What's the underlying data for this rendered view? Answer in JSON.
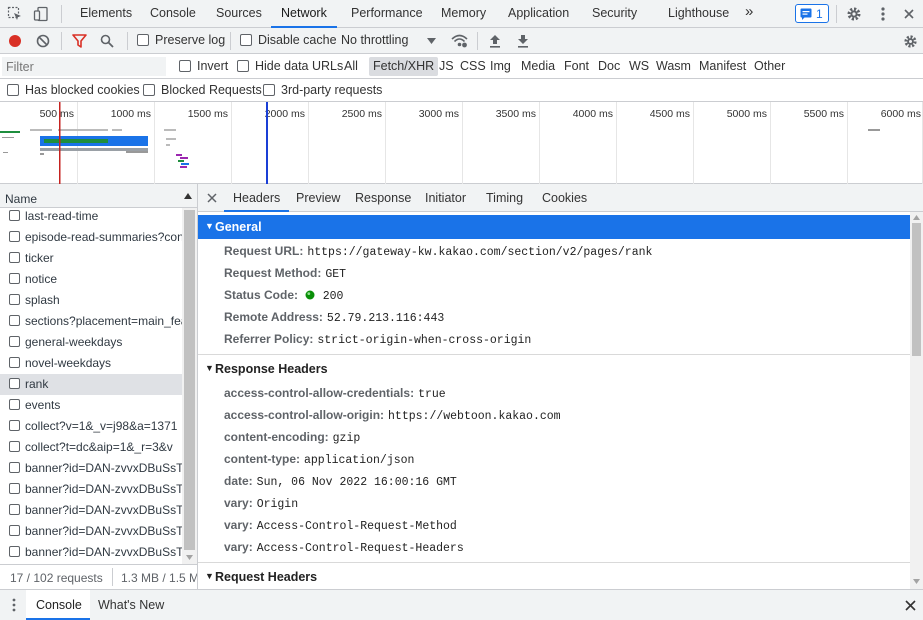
{
  "topbar": {
    "tabs": [
      {
        "label": "Elements"
      },
      {
        "label": "Console"
      },
      {
        "label": "Sources"
      },
      {
        "label": "Network"
      },
      {
        "label": "Performance"
      },
      {
        "label": "Memory"
      },
      {
        "label": "Application"
      },
      {
        "label": "Security"
      },
      {
        "label": "Lighthouse"
      }
    ],
    "more_tabs": "»",
    "issues_count": "1"
  },
  "toolbar": {
    "preserve_log": "Preserve log",
    "disable_cache": "Disable cache",
    "throttling": "No throttling"
  },
  "filter": {
    "placeholder": "Filter",
    "invert": "Invert",
    "hide_data_urls": "Hide data URLs",
    "types": [
      "All",
      "Fetch/XHR",
      "JS",
      "CSS",
      "Img",
      "Media",
      "Font",
      "Doc",
      "WS",
      "Wasm",
      "Manifest",
      "Other"
    ],
    "active_type": "Fetch/XHR",
    "has_blocked_cookies": "Has blocked cookies",
    "blocked_requests": "Blocked Requests",
    "third_party": "3rd-party requests"
  },
  "timeline": {
    "ticks": [
      "500 ms",
      "1000 ms",
      "1500 ms",
      "2000 ms",
      "2500 ms",
      "3000 ms",
      "3500 ms",
      "4000 ms",
      "4500 ms",
      "5000 ms",
      "5500 ms",
      "6000 ms"
    ]
  },
  "requests": {
    "column": "Name",
    "items": [
      "last-read-time",
      "episode-read-summaries?con",
      "ticker",
      "notice",
      "splash",
      "sections?placement=main_fea",
      "general-weekdays",
      "novel-weekdays",
      "rank",
      "events",
      "collect?v=1&_v=j98&a=1371",
      "collect?t=dc&aip=1&_r=3&v",
      "banner?id=DAN-zvvxDBuSsTr",
      "banner?id=DAN-zvvxDBuSsTr",
      "banner?id=DAN-zvvxDBuSsTr",
      "banner?id=DAN-zvvxDBuSsTr",
      "banner?id=DAN-zvvxDBuSsTr"
    ],
    "selected": "rank"
  },
  "status": {
    "requests": "17 / 102 requests",
    "transferred": "1.3 MB / 1.5 M"
  },
  "details": {
    "tabs": [
      "Headers",
      "Preview",
      "Response",
      "Initiator",
      "Timing",
      "Cookies"
    ],
    "active_tab": "Headers",
    "general": {
      "title": "General",
      "rows": [
        {
          "k": "Request URL:",
          "v": "https://gateway-kw.kakao.com/section/v2/pages/rank"
        },
        {
          "k": "Request Method:",
          "v": "GET"
        },
        {
          "k": "Status Code:",
          "v": "200"
        },
        {
          "k": "Remote Address:",
          "v": "52.79.213.116:443"
        },
        {
          "k": "Referrer Policy:",
          "v": "strict-origin-when-cross-origin"
        }
      ]
    },
    "response_headers": {
      "title": "Response Headers",
      "rows": [
        {
          "k": "access-control-allow-credentials:",
          "v": "true"
        },
        {
          "k": "access-control-allow-origin:",
          "v": "https://webtoon.kakao.com"
        },
        {
          "k": "content-encoding:",
          "v": "gzip"
        },
        {
          "k": "content-type:",
          "v": "application/json"
        },
        {
          "k": "date:",
          "v": "Sun, 06 Nov 2022 16:00:16 GMT"
        },
        {
          "k": "vary:",
          "v": "Origin"
        },
        {
          "k": "vary:",
          "v": "Access-Control-Request-Method"
        },
        {
          "k": "vary:",
          "v": "Access-Control-Request-Headers"
        }
      ]
    },
    "request_headers": {
      "title": "Request Headers"
    }
  },
  "drawer": {
    "tabs": [
      "Console",
      "What's New"
    ]
  },
  "colors": {
    "accent": "#1a73e8",
    "record": "#d93025",
    "filter_active": "#d93025",
    "status_ok": "#0a8f08"
  }
}
